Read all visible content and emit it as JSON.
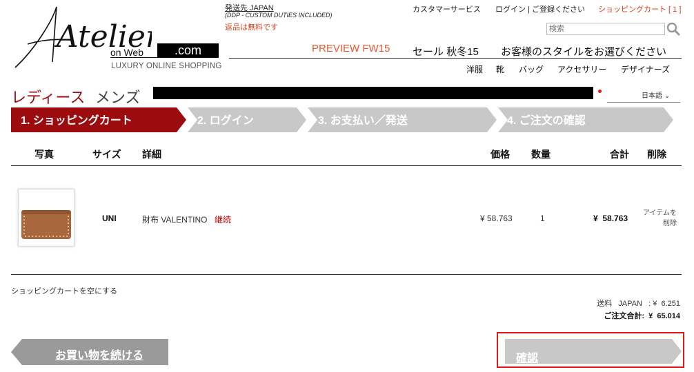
{
  "logo": {
    "script": "Atelier",
    "on_web": "on Web",
    "dotcom": ".com",
    "tagline": "LUXURY ONLINE SHOPPING"
  },
  "shipping": {
    "destination": "発送先 JAPAN",
    "ddp": "(DDP - CUSTOM DUTIES INCLUDED)",
    "returns": "返品は無料です"
  },
  "toplinks": {
    "customer_service": "カスタマーサービス",
    "login": "ログイン | ご登録ください",
    "cart": "ショッピングカート [ 1 ]"
  },
  "search": {
    "placeholder": "検索"
  },
  "nav": {
    "preview": "PREVIEW FW15",
    "sale": "セール 秋冬15",
    "style": "お客様のスタイルをお選びください",
    "sub": [
      "洋服",
      "靴",
      "バッグ",
      "アクセサリー",
      "デザイナーズ"
    ]
  },
  "gender": {
    "ladies": "レディース",
    "mens": "メンズ"
  },
  "language": {
    "selected": "日本語"
  },
  "steps": [
    {
      "label": "1. ショッピングカート",
      "active": true
    },
    {
      "label": "2. ログイン",
      "active": false
    },
    {
      "label": "3. お支払い／発送",
      "active": false
    },
    {
      "label": "4. ご注文の確認",
      "active": false
    }
  ],
  "table": {
    "headers": {
      "photo": "写真",
      "size": "サイズ",
      "detail": "詳細",
      "price": "価格",
      "qty": "数量",
      "total": "合計",
      "delete": "削除"
    },
    "rows": [
      {
        "size": "UNI",
        "name": "財布 VALENTINO",
        "continue": "継続",
        "price": "¥ 58.763",
        "qty": "1",
        "total": "¥  58.763",
        "remove_line1": "アイテムを",
        "remove_line2": "削除"
      }
    ]
  },
  "empty_cart": "ショッピングカートを空にする",
  "summary": {
    "shipping": "送料   JAPAN   : ¥  6.251",
    "order_total": "ご注文合計:  ¥  65.014"
  },
  "buttons": {
    "continue_shopping": "お買い物を続ける",
    "confirm": "確認"
  },
  "colors": {
    "accent_red": "#9c0c0f",
    "orange": "#e8562a",
    "step_gray": "#c8c8c8",
    "button_gray": "#9a9a9a"
  }
}
